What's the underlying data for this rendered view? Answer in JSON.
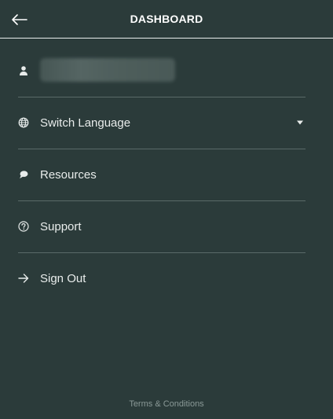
{
  "header": {
    "title": "DASHBOARD",
    "back_icon": "arrow-left-icon"
  },
  "menu": {
    "user": {
      "icon": "person-icon",
      "name": ""
    },
    "items": [
      {
        "label": "Switch Language",
        "icon": "globe-icon",
        "has_dropdown": true
      },
      {
        "label": "Resources",
        "icon": "chat-bubble-icon"
      },
      {
        "label": "Support",
        "icon": "help-circle-icon"
      },
      {
        "label": "Sign Out",
        "icon": "arrow-right-icon"
      }
    ]
  },
  "footer": {
    "terms_label": "Terms & Conditions"
  },
  "colors": {
    "background": "#2b3b3a",
    "text": "#e8eceb",
    "divider": "#5a6a68",
    "footer_text": "#8a9997"
  }
}
